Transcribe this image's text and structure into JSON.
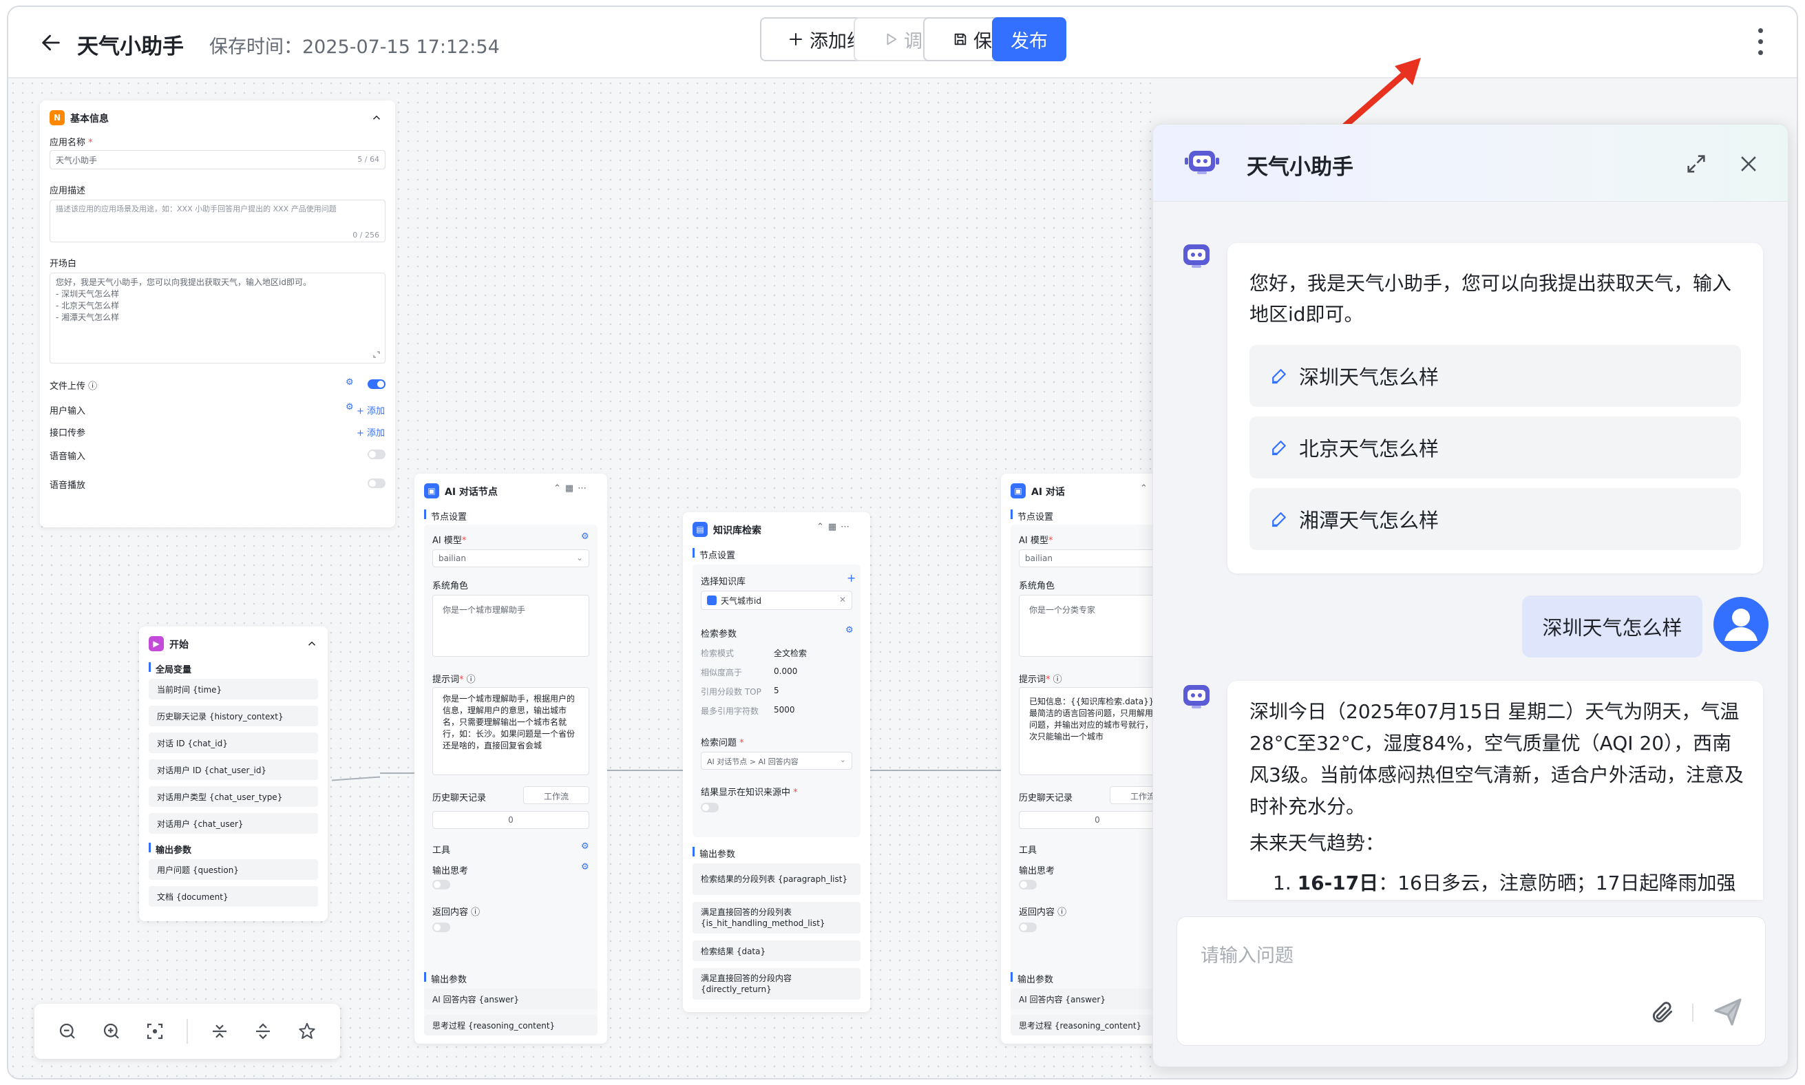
{
  "header": {
    "title": "天气小助手",
    "save_time": "保存时间：2025-07-15 17:12:54",
    "buttons": {
      "add_component": "添加组件",
      "debug": "调试",
      "save": "保存",
      "publish": "发布"
    }
  },
  "basic_info": {
    "title": "基本信息",
    "app_name_label": "应用名称",
    "app_name_value": "天气小助手",
    "app_name_count": "5 / 64",
    "app_desc_label": "应用描述",
    "app_desc_placeholder": "描述该应用的应用场景及用途，如：XXX 小助手回答用户提出的 XXX 产品使用问题",
    "app_desc_count": "0 / 256",
    "opening_label": "开场白",
    "opening_lines": [
      "您好，我是天气小助手，您可以向我提出获取天气，输入地区id即可。",
      "- 深圳天气怎么样",
      "- 北京天气怎么样",
      "- 湘潭天气怎么样"
    ],
    "file_upload_label": "文件上传",
    "user_input_label": "用户输入",
    "interface_param_label": "接口传参",
    "add_label": "+ 添加",
    "voice_input_label": "语音输入",
    "voice_play_label": "语音播放"
  },
  "start_node": {
    "title": "开始",
    "global_vars_label": "全局变量",
    "global_vars": [
      "当前时间 {time}",
      "历史聊天记录 {history_context}",
      "对话 ID {chat_id}",
      "对话用户 ID {chat_user_id}",
      "对话用户类型 {chat_user_type}",
      "对话用户 {chat_user}"
    ],
    "output_label": "输出参数",
    "outputs": [
      "用户问题 {question}",
      "文档 {document}"
    ]
  },
  "ai_node1": {
    "title": "AI 对话节点",
    "settings_label": "节点设置",
    "model_label": "AI 模型",
    "model_value": "bailian",
    "role_label": "系统角色",
    "role_value": "你是一个城市理解助手",
    "prompt_label": "提示词",
    "prompt_value": "你是一个城市理解助手，根据用户的信息，理解用户的意思，输出城市名，只需要理解输出一个城市名就行，如：长沙。如果问题是一个省份还是啥的，直接回复省会城",
    "history_label": "历史聊天记录",
    "history_mode": "工作流",
    "history_count": "0",
    "tools_label": "工具",
    "think_label": "输出思考",
    "return_label": "返回内容",
    "output_label": "输出参数",
    "outputs": [
      "AI 回答内容 {answer}",
      "思考过程 {reasoning_content}"
    ]
  },
  "kb_node": {
    "title": "知识库检索",
    "settings_label": "节点设置",
    "select_kb_label": "选择知识库",
    "kb_item": "天气城市id",
    "search_params_label": "检索参数",
    "params": [
      {
        "k": "检索模式",
        "v": "全文检索"
      },
      {
        "k": "相似度高于",
        "v": "0.000"
      },
      {
        "k": "引用分段数 TOP",
        "v": "5"
      },
      {
        "k": "最多引用字符数",
        "v": "5000"
      }
    ],
    "question_label": "检索问题",
    "question_value": "AI 对话节点 > AI 回答内容",
    "display_label": "结果显示在知识来源中",
    "output_label": "输出参数",
    "outputs": [
      "检索结果的分段列表 {paragraph_list}",
      "满足直接回答的分段列表 {is_hit_handling_method_list}",
      "检索结果 {data}",
      "满足直接回答的分段内容 {directly_return}"
    ]
  },
  "ai_node2": {
    "title": "AI 对话",
    "settings_label": "节点设置",
    "model_label": "AI 模型",
    "model_value": "bailian",
    "role_label": "系统角色",
    "role_value": "你是一个分类专家",
    "prompt_label": "提示词",
    "prompt_value": "已知信息：{{知识库检索.data}} 用最简洁的语言回答问题，只用解用户问题，并输出对应的城市号就行，一次只能输出一个城市",
    "history_label": "历史聊天记录",
    "history_mode": "工作流",
    "history_count": "0",
    "tools_label": "工具",
    "think_label": "输出思考",
    "return_label": "返回内容",
    "output_label": "输出参数",
    "outputs": [
      "AI 回答内容 {answer}",
      "思考过程 {reasoning_content}"
    ]
  },
  "chat": {
    "title": "天气小助手",
    "greeting": "您好，我是天气小助手，您可以向我提出获取天气，输入地区id即可。",
    "suggestions": [
      "深圳天气怎么样",
      "北京天气怎么样",
      "湘潭天气怎么样"
    ],
    "user_message": "深圳天气怎么样",
    "answer": "深圳今日（2025年07月15日 星期二）天气为阴天，气温28°C至32°C，湿度84%，空气质量优（AQI 20），西南风3级。当前体感闷热但空气清新，适合户外活动，注意及时补充水分。",
    "trend_label": "未来天气趋势：",
    "trend_item_num": "1.",
    "trend_item_bold": "16-17日",
    "trend_item_text": "：16日多云，注意防晒；17日起降雨加强",
    "input_placeholder": "请输入问题"
  },
  "colors": {
    "primary": "#3370ff",
    "bot_purple": "#5b5bd6",
    "arrow_red": "#e8321f"
  }
}
